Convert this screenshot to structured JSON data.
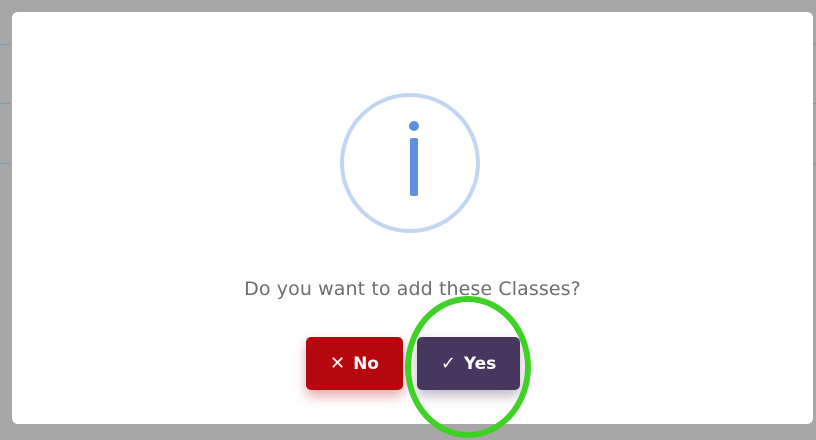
{
  "dialog": {
    "message": "Do you want to add these Classes?",
    "icon": "info-icon",
    "no_button": {
      "label": "No",
      "icon": "close-icon",
      "icon_glyph": "✕"
    },
    "yes_button": {
      "label": "Yes",
      "icon": "check-icon",
      "icon_glyph": "✓"
    }
  },
  "colors": {
    "no_button": "#b5070d",
    "yes_button": "#47375e",
    "info_ring": "#c2d6f3",
    "info_glyph": "#5d90e2",
    "annotation_ring": "#3fd126"
  }
}
